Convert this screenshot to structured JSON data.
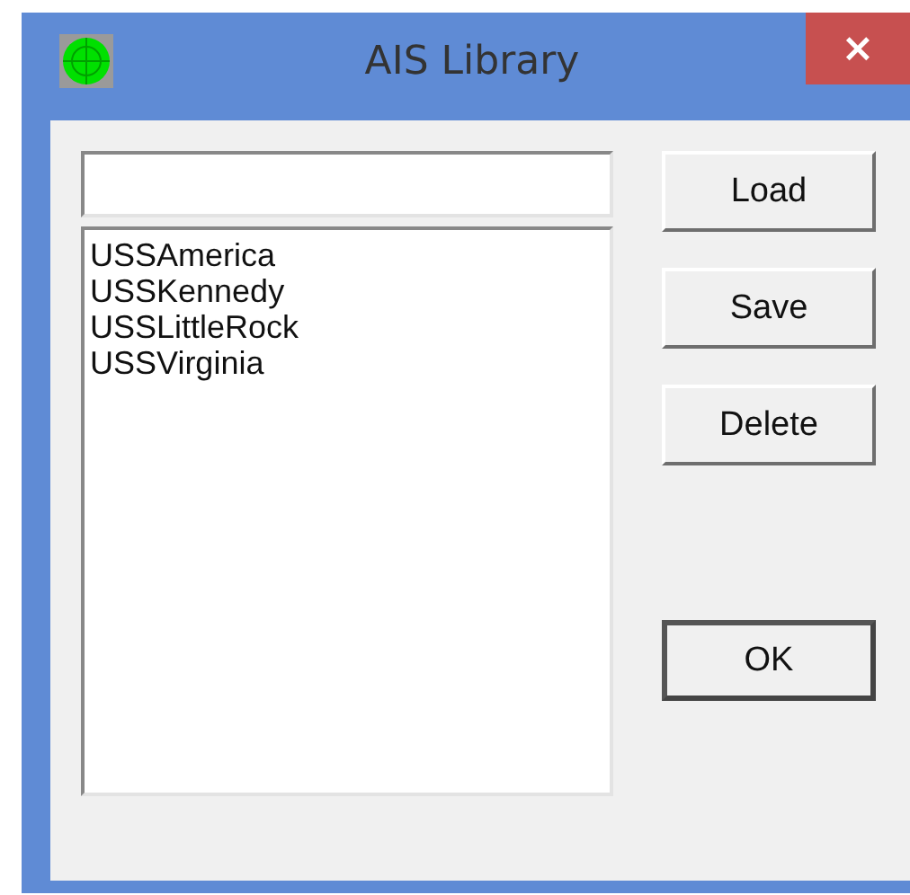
{
  "window": {
    "title": "AIS Library",
    "close": "×"
  },
  "list": {
    "items": [
      {
        "label": "USSAmerica",
        "selected": false
      },
      {
        "label": "USSKennedy",
        "selected": false
      },
      {
        "label": "USSLittleRock",
        "selected": false
      },
      {
        "label": "USSVirginia",
        "selected": false
      }
    ]
  },
  "buttons": [
    {
      "label": "Load"
    },
    {
      "label": "Save"
    },
    {
      "label": "Delete"
    },
    {
      "label": "OK",
      "kind": "default"
    }
  ]
}
